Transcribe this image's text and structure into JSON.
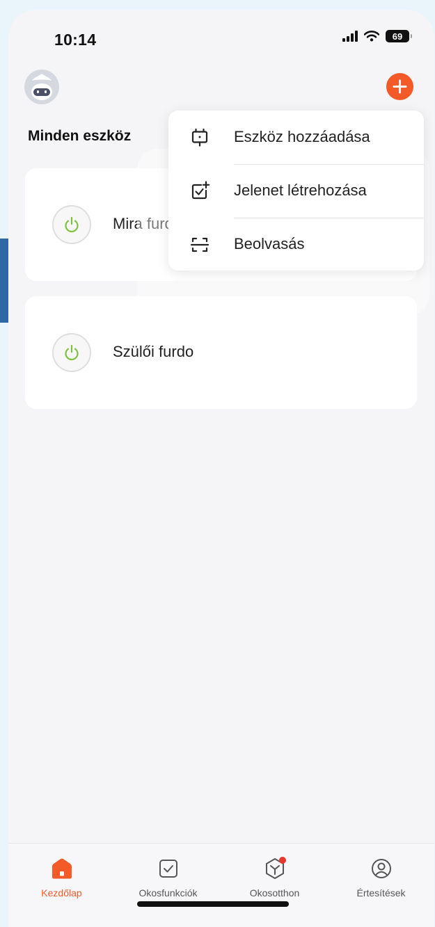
{
  "status_bar": {
    "time": "10:14",
    "battery": "69"
  },
  "header": {
    "section_title": "Minden eszköz"
  },
  "devices": [
    {
      "name": "Mira furdo"
    },
    {
      "name": "Szülői furdo"
    }
  ],
  "dropdown": {
    "items": [
      {
        "label": "Eszköz hozzáadása",
        "icon": "add-device-icon"
      },
      {
        "label": "Jelenet létrehozása",
        "icon": "create-scene-icon"
      },
      {
        "label": "Beolvasás",
        "icon": "scan-icon"
      }
    ]
  },
  "tab_bar": {
    "items": [
      {
        "label": "Kezdőlap",
        "icon": "home-icon",
        "active": true
      },
      {
        "label": "Okosfunkciók",
        "icon": "smart-functions-icon"
      },
      {
        "label": "Okosotthon",
        "icon": "smart-home-icon",
        "badge": true
      },
      {
        "label": "Értesítések",
        "icon": "profile-icon"
      }
    ]
  },
  "colors": {
    "accent": "#f35a28",
    "power_green": "#7dc243",
    "background": "#f5f5f7"
  }
}
